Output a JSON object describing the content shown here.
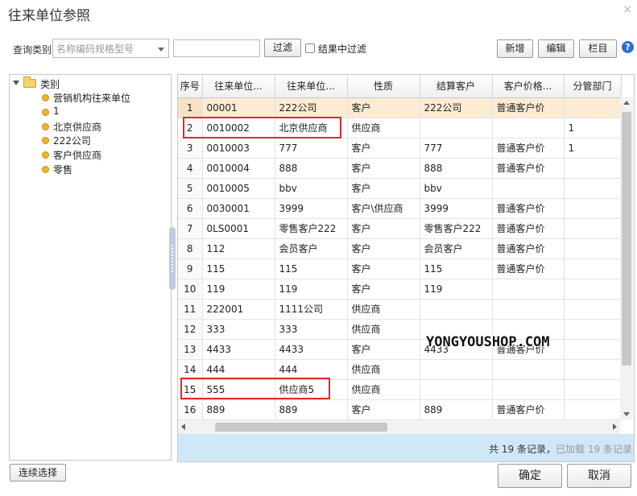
{
  "dialog": {
    "title": "往来单位参照",
    "close_symbol": "×"
  },
  "toolbar": {
    "query_label": "查询类别",
    "query_select_value": "名称编码规格型号",
    "filter_button": "过滤",
    "filter_in_results": "结果中过滤",
    "add_button": "新增",
    "edit_button": "编辑",
    "columns_button": "栏目",
    "help_symbol": "?"
  },
  "tree": {
    "root_label": "类别",
    "items": [
      {
        "label": "营销机构往来单位"
      },
      {
        "label": "1"
      },
      {
        "label": "北京供应商"
      },
      {
        "label": "222公司"
      },
      {
        "label": "客户供应商"
      },
      {
        "label": "零售"
      }
    ]
  },
  "grid": {
    "columns": [
      "序号",
      "往来单位...",
      "往来单位...",
      "性质",
      "结算客户",
      "客户价格...",
      "分管部门"
    ],
    "rows": [
      [
        "1",
        "00001",
        "222公司",
        "客户",
        "222公司",
        "普通客户价",
        ""
      ],
      [
        "2",
        "0010002",
        "北京供应商",
        "供应商",
        "",
        "",
        "1"
      ],
      [
        "3",
        "0010003",
        "777",
        "客户",
        "777",
        "普通客户价",
        "1"
      ],
      [
        "4",
        "0010004",
        "888",
        "客户",
        "888",
        "普通客户价",
        ""
      ],
      [
        "5",
        "0010005",
        "bbv",
        "客户",
        "bbv",
        "",
        ""
      ],
      [
        "6",
        "0030001",
        "3999",
        "客户\\供应商",
        "3999",
        "普通客户价",
        ""
      ],
      [
        "7",
        "0LS0001",
        "零售客户222",
        "客户",
        "零售客户222",
        "普通客户价",
        ""
      ],
      [
        "8",
        "112",
        "会员客户",
        "客户",
        "会员客户",
        "普通客户价",
        ""
      ],
      [
        "9",
        "115",
        "115",
        "客户",
        "115",
        "普通客户价",
        ""
      ],
      [
        "10",
        "119",
        "119",
        "客户",
        "119",
        "",
        ""
      ],
      [
        "11",
        "222001",
        "1111公司",
        "供应商",
        "",
        "",
        ""
      ],
      [
        "12",
        "333",
        "333",
        "供应商",
        "",
        "",
        ""
      ],
      [
        "13",
        "4433",
        "4433",
        "客户",
        "4433",
        "普通客户价",
        ""
      ],
      [
        "14",
        "444",
        "444",
        "供应商",
        "",
        "",
        ""
      ],
      [
        "15",
        "555",
        "供应商5",
        "供应商",
        "",
        "",
        ""
      ],
      [
        "16",
        "889",
        "889",
        "客户",
        "889",
        "普通客户价",
        ""
      ]
    ],
    "selected_row": 1
  },
  "footer": {
    "total_prefix": "共",
    "total_count": "19",
    "total_suffix": "条记录，",
    "loaded_prefix": "已加载",
    "loaded_count": "19",
    "loaded_suffix": "条记录"
  },
  "watermark": "YONGYOUSHOP.COM",
  "bottom": {
    "continuous_select": "连续选择",
    "ok_button": "确定",
    "cancel_button": "取消"
  },
  "colors": {
    "selected_row": "#fcecd4",
    "footer_bar": "#cfe7f6",
    "highlight_box": "#e0282e",
    "help_icon": "#2f6fce"
  }
}
